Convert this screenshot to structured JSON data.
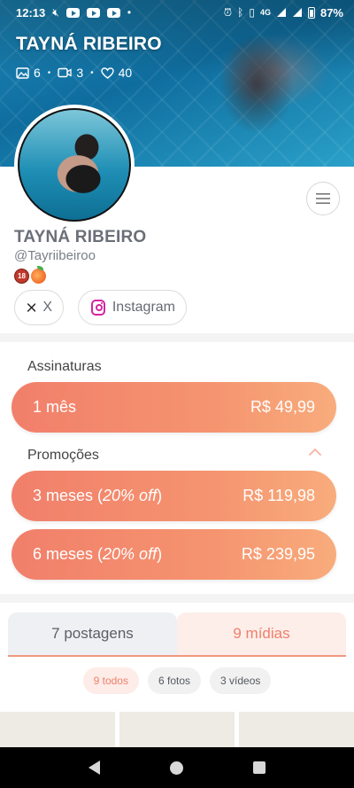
{
  "status_bar": {
    "time": "12:13",
    "network": "4G",
    "battery": "87%"
  },
  "cover": {
    "title": "TAYNÁ RIBEIRO",
    "stats": {
      "photos": "6",
      "videos": "3",
      "likes": "40"
    }
  },
  "profile": {
    "name": "TAYNÁ RIBEIRO",
    "handle": "@Tayriibeiroo",
    "badge_18": "18"
  },
  "social": {
    "x_label": "X",
    "instagram_label": "Instagram"
  },
  "subscriptions": {
    "title": "Assinaturas",
    "plan": {
      "label": "1 mês",
      "price": "R$ 49,99"
    }
  },
  "promotions": {
    "title": "Promoções",
    "items": [
      {
        "label": "3 meses",
        "discount": "20% off",
        "price": "R$ 119,98"
      },
      {
        "label": "6 meses",
        "discount": "20% off",
        "price": "R$ 239,95"
      }
    ]
  },
  "tabs": {
    "posts": "7 postagens",
    "media": "9 mídias"
  },
  "filters": {
    "all": "9 todos",
    "photos": "6 fotos",
    "videos": "3 vídeos"
  },
  "colors": {
    "accent": "#ef7f6c",
    "gradient_start": "#f17f6b",
    "gradient_end": "#f8ac7c"
  }
}
